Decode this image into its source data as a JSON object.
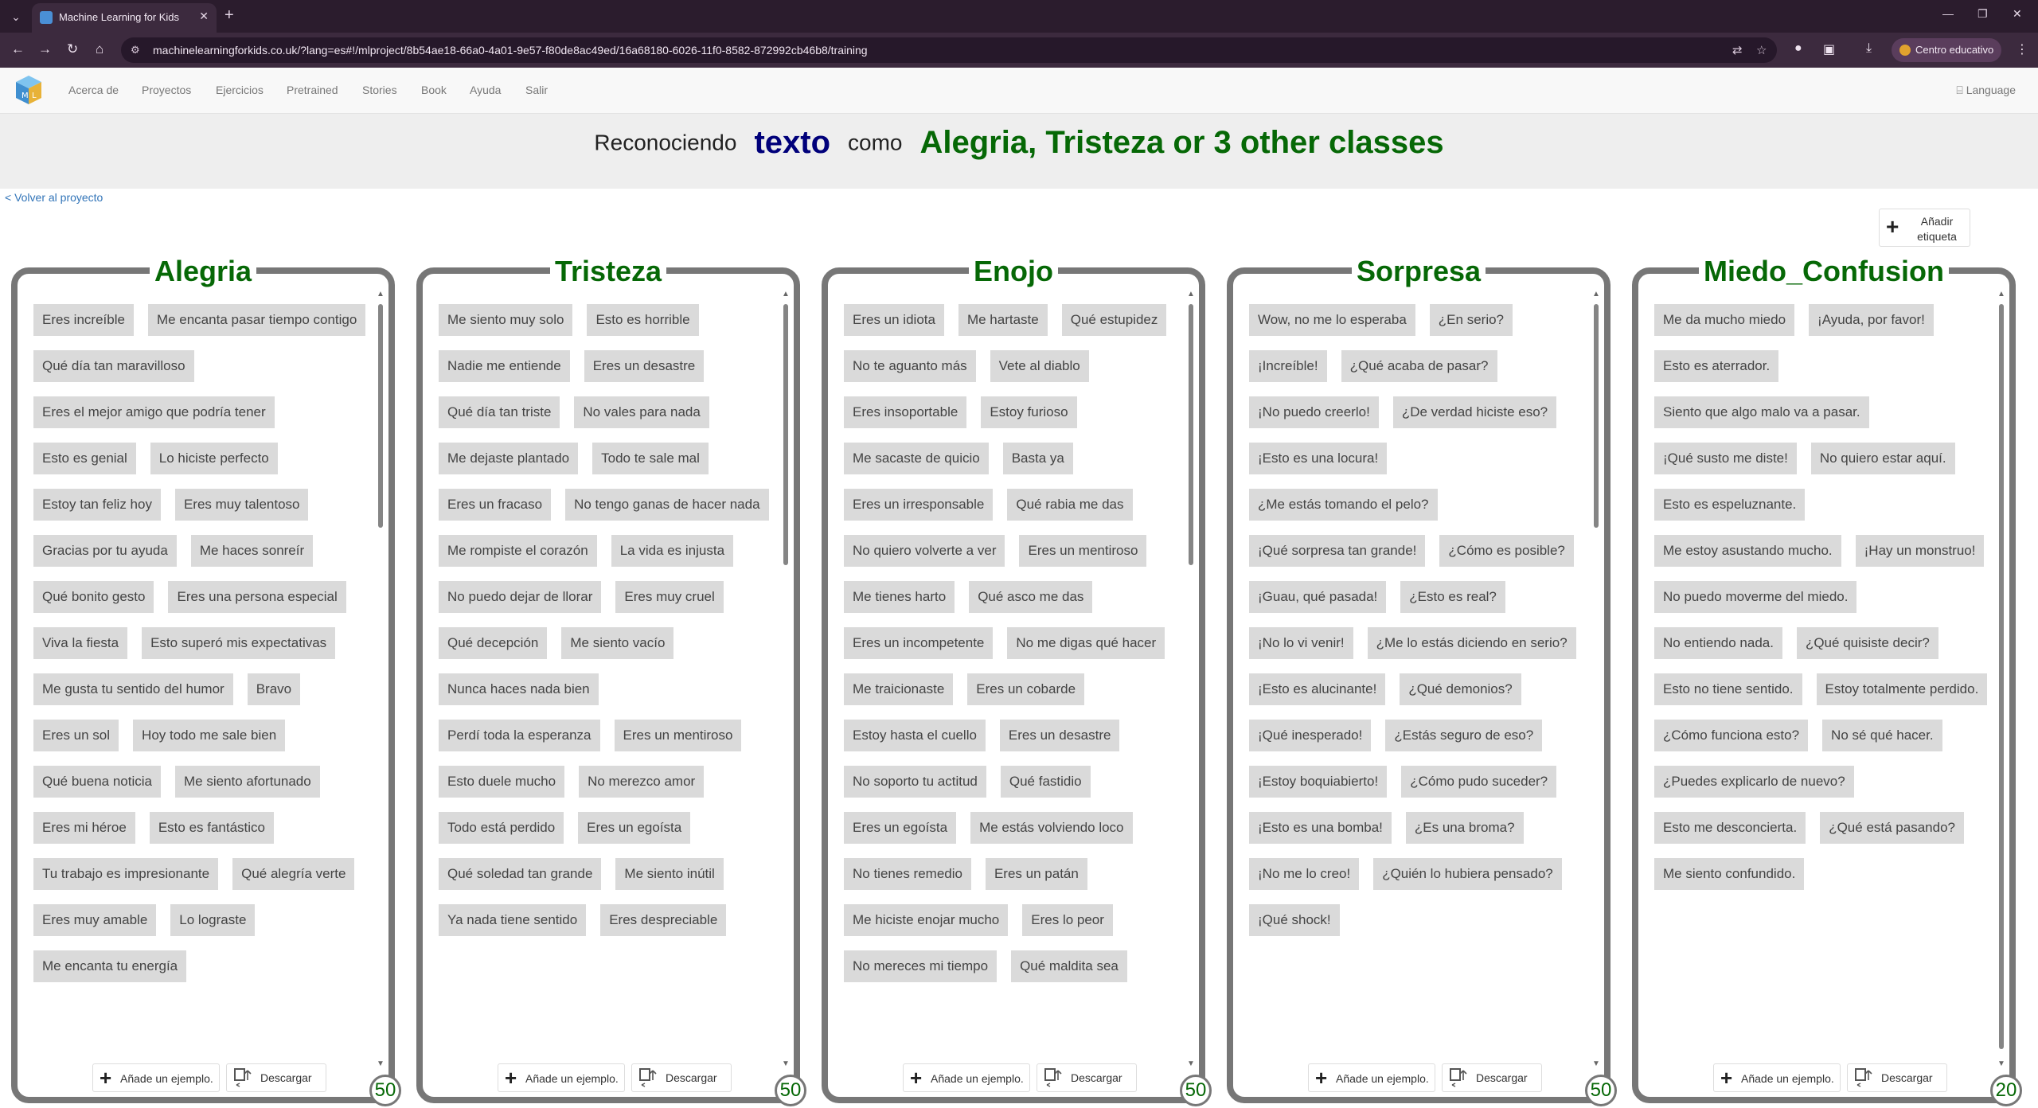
{
  "browser": {
    "tab_title": "Machine Learning for Kids",
    "url": "machinelearningforkids.co.uk/?lang=es#!/mlproject/8b54ae18-66a0-4a01-9e57-f80de8ac49ed/16a68180-6026-11f0-8582-872992cb46b8/training",
    "profile_label": "Centro educativo"
  },
  "nav": {
    "items": [
      "Acerca de",
      "Proyectos",
      "Ejercicios",
      "Pretrained",
      "Stories",
      "Book",
      "Ayuda",
      "Salir"
    ],
    "language": "Language"
  },
  "banner": {
    "prefix": "Reconociendo",
    "type": "texto",
    "middle": "como",
    "classes": "Alegria, Tristeza or 3 other classes"
  },
  "back_link": "< Volver al proyecto",
  "add_label_button": "Añadir etiqueta",
  "buttons": {
    "add_example": "Añade un ejemplo.",
    "download": "Descargar"
  },
  "buckets": [
    {
      "label": "Alegria",
      "count": "50",
      "scroll_fraction": 0.3,
      "examples": [
        "Eres increíble",
        "Me encanta pasar tiempo contigo",
        "Qué día tan maravilloso",
        "Eres el mejor amigo que podría tener",
        "Esto es genial",
        "Lo hiciste perfecto",
        "Estoy tan feliz hoy",
        "Eres muy talentoso",
        "Gracias por tu ayuda",
        "Me haces sonreír",
        "Qué bonito gesto",
        "Eres una persona especial",
        "Viva la fiesta",
        "Esto superó mis expectativas",
        "Me gusta tu sentido del humor",
        "Bravo",
        "Eres un sol",
        "Hoy todo me sale bien",
        "Qué buena noticia",
        "Me siento afortunado",
        "Eres mi héroe",
        "Esto es fantástico",
        "Tu trabajo es impresionante",
        "Qué alegría verte",
        "Eres muy amable",
        "Lo lograste",
        "Me encanta tu energía"
      ]
    },
    {
      "label": "Tristeza",
      "count": "50",
      "scroll_fraction": 0.35,
      "examples": [
        "Me siento muy solo",
        "Esto es horrible",
        "Nadie me entiende",
        "Eres un desastre",
        "Qué día tan triste",
        "No vales para nada",
        "Me dejaste plantado",
        "Todo te sale mal",
        "Eres un fracaso",
        "No tengo ganas de hacer nada",
        "Me rompiste el corazón",
        "La vida es injusta",
        "No puedo dejar de llorar",
        "Eres muy cruel",
        "Qué decepción",
        "Me siento vacío",
        "Nunca haces nada bien",
        "Perdí toda la esperanza",
        "Eres un mentiroso",
        "Esto duele mucho",
        "No merezco amor",
        "Todo está perdido",
        "Eres un egoísta",
        "Qué soledad tan grande",
        "Me siento inútil",
        "Ya nada tiene sentido",
        "Eres despreciable"
      ]
    },
    {
      "label": "Enojo",
      "count": "50",
      "scroll_fraction": 0.35,
      "examples": [
        "Eres un idiota",
        "Me hartaste",
        "Qué estupidez",
        "No te aguanto más",
        "Vete al diablo",
        "Eres insoportable",
        "Estoy furioso",
        "Me sacaste de quicio",
        "Basta ya",
        "Eres un irresponsable",
        "Qué rabia me das",
        "No quiero volverte a ver",
        "Eres un mentiroso",
        "Me tienes harto",
        "Qué asco me das",
        "Eres un incompetente",
        "No me digas qué hacer",
        "Me traicionaste",
        "Eres un cobarde",
        "Estoy hasta el cuello",
        "Eres un desastre",
        "No soporto tu actitud",
        "Qué fastidio",
        "Eres un egoísta",
        "Me estás volviendo loco",
        "No tienes remedio",
        "Eres un patán",
        "Me hiciste enojar mucho",
        "Eres lo peor",
        "No mereces mi tiempo",
        "Qué maldita sea"
      ]
    },
    {
      "label": "Sorpresa",
      "count": "50",
      "scroll_fraction": 0.3,
      "examples": [
        "Wow, no me lo esperaba",
        "¿En serio?",
        "¡Increíble!",
        "¿Qué acaba de pasar?",
        "¡No puedo creerlo!",
        "¿De verdad hiciste eso?",
        "¡Esto es una locura!",
        "¿Me estás tomando el pelo?",
        "¡Qué sorpresa tan grande!",
        "¿Cómo es posible?",
        "¡Guau, qué pasada!",
        "¿Esto es real?",
        "¡No lo vi venir!",
        "¿Me lo estás diciendo en serio?",
        "¡Esto es alucinante!",
        "¿Qué demonios?",
        "¡Qué inesperado!",
        "¿Estás seguro de eso?",
        "¡Estoy boquiabierto!",
        "¿Cómo pudo suceder?",
        "¡Esto es una bomba!",
        "¿Es una broma?",
        "¡No me lo creo!",
        "¿Quién lo hubiera pensado?",
        "¡Qué shock!"
      ]
    },
    {
      "label": "Miedo_Confusion",
      "count": "20",
      "scroll_fraction": 1,
      "examples": [
        "Me da mucho miedo",
        "¡Ayuda, por favor!",
        "Esto es aterrador.",
        "Siento que algo malo va a pasar.",
        "¡Qué susto me diste!",
        "No quiero estar aquí.",
        "Esto es espeluznante.",
        "Me estoy asustando mucho.",
        "¡Hay un monstruo!",
        "No puedo moverme del miedo.",
        "No entiendo nada.",
        "¿Qué quisiste decir?",
        "Esto no tiene sentido.",
        "Estoy totalmente perdido.",
        "¿Cómo funciona esto?",
        "No sé qué hacer.",
        "¿Puedes explicarlo de nuevo?",
        "Esto me desconcierta.",
        "¿Qué está pasando?",
        "Me siento confundido."
      ]
    }
  ]
}
